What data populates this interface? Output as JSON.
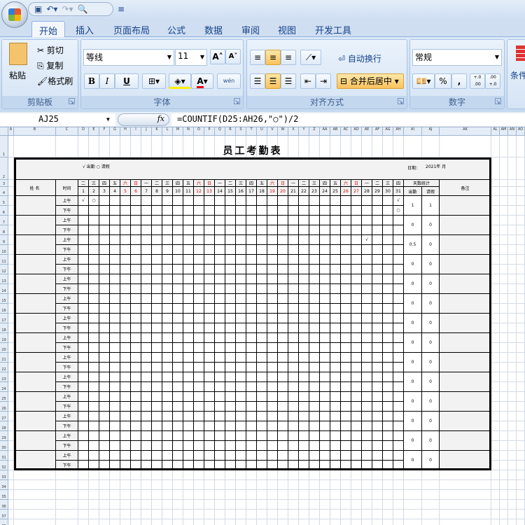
{
  "ribbon": {
    "tabs": [
      "开始",
      "插入",
      "页面布局",
      "公式",
      "数据",
      "审阅",
      "视图",
      "开发工具"
    ],
    "clipboard": {
      "paste": "粘贴",
      "cut": "剪切",
      "copy": "复制",
      "format_painter": "格式刷",
      "label": "剪贴板"
    },
    "font": {
      "name": "等线",
      "size": "11",
      "bold": "B",
      "italic": "I",
      "underline": "U",
      "phonetic": "wén",
      "label": "字体"
    },
    "alignment": {
      "wrap": "自动换行",
      "merge": "合并后居中",
      "label": "对齐方式"
    },
    "number": {
      "format": "常规",
      "percent": "%",
      "comma": ",",
      "inc": "+.0 .00",
      "dec": ".00 +.0",
      "label": "数字"
    },
    "styles": {
      "cond": "条件"
    }
  },
  "formula_bar": {
    "cell": "AJ25",
    "fx": "fx",
    "formula": "=COUNTIF(D25:AH26,\"○\")/2"
  },
  "columns": [
    "A",
    "B",
    "C",
    "D",
    "E",
    "F",
    "G",
    "H",
    "I",
    "J",
    "K",
    "L",
    "M",
    "N",
    "O",
    "P",
    "Q",
    "R",
    "S",
    "T",
    "U",
    "V",
    "W",
    "X",
    "Y",
    "Z",
    "AA",
    "AB",
    "AC",
    "AD",
    "AE",
    "AF",
    "AG",
    "AH",
    "AI",
    "AJ",
    "AK",
    "AL",
    "AM",
    "AN",
    "AO"
  ],
  "sheet": {
    "title": "员工考勤表",
    "legend": "√  出勤   ○  请假",
    "date_label": "日期：",
    "date_value": "2021年   月",
    "name_header": "姓 名",
    "time_header": "时间",
    "stats_header": "天数统计",
    "attend_header": "出勤",
    "leave_header": "请假",
    "remark_header": "备注",
    "am": "上午",
    "pm": "下午",
    "weekdays": [
      "二",
      "三",
      "四",
      "五",
      "六",
      "日",
      "一",
      "二",
      "三",
      "四",
      "五",
      "六",
      "日",
      "一",
      "二",
      "三",
      "四",
      "五",
      "六",
      "日",
      "一",
      "二",
      "三",
      "四",
      "五",
      "六",
      "日",
      "一",
      "二",
      "三",
      "四"
    ],
    "days": [
      "1",
      "2",
      "3",
      "4",
      "5",
      "6",
      "7",
      "8",
      "9",
      "10",
      "11",
      "12",
      "13",
      "14",
      "15",
      "16",
      "17",
      "18",
      "19",
      "20",
      "21",
      "22",
      "23",
      "24",
      "25",
      "26",
      "27",
      "28",
      "29",
      "30",
      "31"
    ],
    "weekend_color": "#e00000",
    "marks": [
      {
        "group": 0,
        "half": 0,
        "day": 1,
        "mark": "√"
      },
      {
        "group": 0,
        "half": 0,
        "day": 2,
        "mark": "○"
      },
      {
        "group": 0,
        "half": 0,
        "day": 31,
        "mark": "√"
      },
      {
        "group": 0,
        "half": 1,
        "day": 31,
        "mark": "○"
      },
      {
        "group": 2,
        "half": 0,
        "day": 28,
        "mark": "√"
      }
    ],
    "stats": [
      [
        "1",
        "1"
      ],
      [
        "0",
        "0"
      ],
      [
        "0.5",
        "0"
      ],
      [
        "0",
        "0"
      ],
      [
        "0",
        "0"
      ],
      [
        "0",
        "0"
      ],
      [
        "0",
        "0"
      ],
      [
        "0",
        "0"
      ],
      [
        "0",
        "0"
      ],
      [
        "0",
        "0"
      ],
      [
        "0",
        "0"
      ],
      [
        "0",
        "0"
      ],
      [
        "0",
        "0"
      ],
      [
        "0",
        "0"
      ]
    ]
  }
}
